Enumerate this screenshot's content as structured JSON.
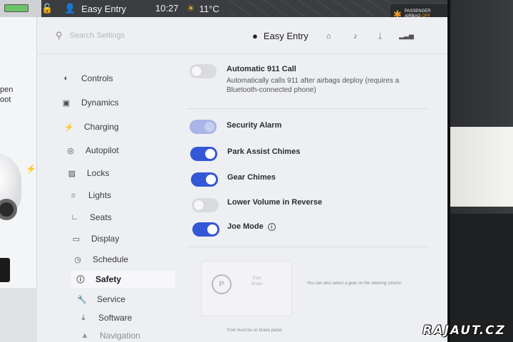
{
  "status_bar": {
    "profile_name": "Easy Entry",
    "time": "10:27",
    "temperature": "11°C",
    "airbag_line1": "PASSENGER",
    "airbag_line2": "AIRBAG",
    "airbag_state": "OFF"
  },
  "car_panel": {
    "text_line1": "pen",
    "text_line2": "oot"
  },
  "search": {
    "placeholder": "Search Settings"
  },
  "profile": {
    "name": "Easy Entry"
  },
  "nav": {
    "items": [
      {
        "label": "Controls",
        "icon": "toggle-icon"
      },
      {
        "label": "Dynamics",
        "icon": "car-icon"
      },
      {
        "label": "Charging",
        "icon": "bolt-icon"
      },
      {
        "label": "Autopilot",
        "icon": "steering-wheel-icon"
      },
      {
        "label": "Locks",
        "icon": "lock-icon"
      },
      {
        "label": "Lights",
        "icon": "sun-icon"
      },
      {
        "label": "Seats",
        "icon": "seat-icon"
      },
      {
        "label": "Display",
        "icon": "display-icon"
      },
      {
        "label": "Schedule",
        "icon": "clock-icon"
      },
      {
        "label": "Safety",
        "icon": "safety-icon",
        "active": true
      },
      {
        "label": "Service",
        "icon": "wrench-icon"
      },
      {
        "label": "Software",
        "icon": "download-icon"
      },
      {
        "label": "Navigation",
        "icon": "navigation-icon"
      }
    ]
  },
  "settings": {
    "auto911": {
      "label": "Automatic 911 Call",
      "description": "Automatically calls 911 after airbags deploy (requires a Bluetooth-connected phone)",
      "on": false
    },
    "security_alarm": {
      "label": "Security Alarm",
      "on": true,
      "disabled": true
    },
    "park_assist": {
      "label": "Park Assist Chimes",
      "on": true
    },
    "gear_chimes": {
      "label": "Gear Chimes",
      "on": true
    },
    "lower_volume": {
      "label": "Lower Volume in Reverse",
      "on": false
    },
    "joe_mode": {
      "label": "Joe Mode",
      "on": true
    }
  },
  "park_card": {
    "title_line1": "Park",
    "title_line2": "Brake",
    "hint_gear": "You can also select a gear on the steering column",
    "hint_foot": "Foot must be on brake pedal"
  },
  "watermark": "RAJAUT.CZ",
  "colors": {
    "accent": "#3457d5",
    "toggle_off": "#dadbdf",
    "toggle_disabled": "#a9b5e6",
    "airbag_off": "#f39a1e"
  }
}
